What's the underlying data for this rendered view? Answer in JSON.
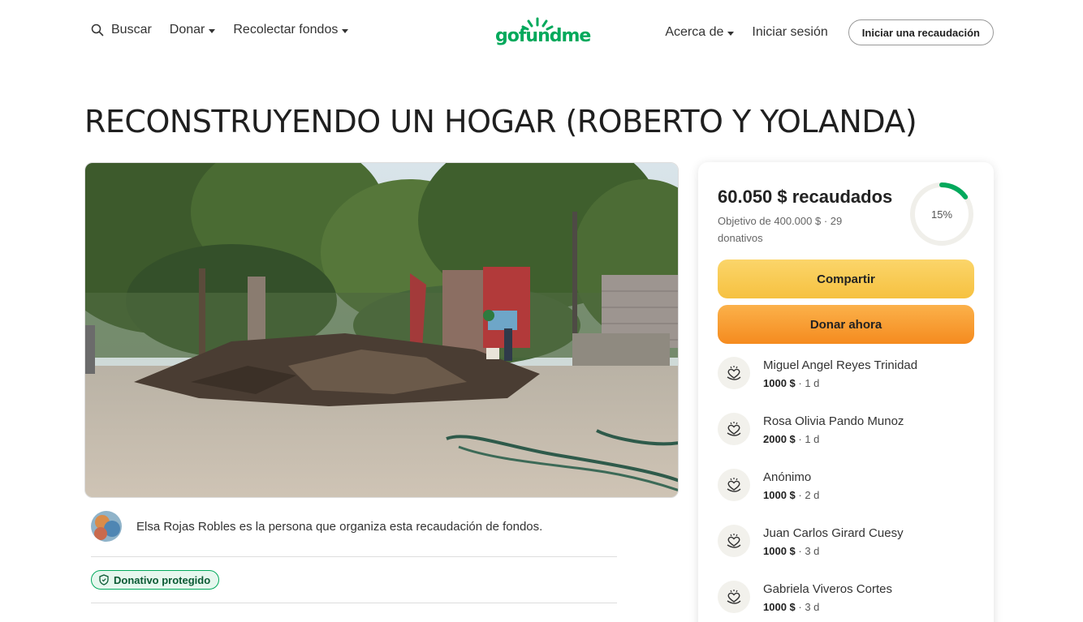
{
  "header": {
    "search_label": "Buscar",
    "donate_label": "Donar",
    "fundraise_label": "Recolectar fondos",
    "logo_text": "gofundme",
    "about_label": "Acerca de",
    "signin_label": "Iniciar sesión",
    "start_label": "Iniciar una recaudación"
  },
  "campaign": {
    "title": "RECONSTRUYENDO UN HOGAR (ROBERTO Y YOLANDA)",
    "organizer_text": "Elsa Rojas Robles es la persona que organiza esta recaudación de fondos.",
    "badge_label": "Donativo protegido"
  },
  "donation_card": {
    "raised_text": "60.050 $ recaudados",
    "goal_text": "Objetivo de 400.000 $  ·  29 donativos",
    "progress_percent": 15,
    "progress_label": "15%",
    "share_label": "Compartir",
    "donate_label": "Donar ahora",
    "donors": [
      {
        "name": "Miguel Angel Reyes Trinidad",
        "amount": "1000 $",
        "time": " · 1 d"
      },
      {
        "name": "Rosa Olivia Pando Munoz",
        "amount": "2000 $",
        "time": " · 1 d"
      },
      {
        "name": "Anónimo",
        "amount": "1000 $",
        "time": " · 2 d"
      },
      {
        "name": "Juan Carlos Girard Cuesy",
        "amount": "1000 $",
        "time": " · 3 d"
      },
      {
        "name": "Gabriela Viveros Cortes",
        "amount": "1000 $",
        "time": " · 3 d"
      }
    ]
  },
  "colors": {
    "brand_green": "#02a95c",
    "share_yellow": "#f6c140",
    "donate_orange": "#f58b1f"
  }
}
